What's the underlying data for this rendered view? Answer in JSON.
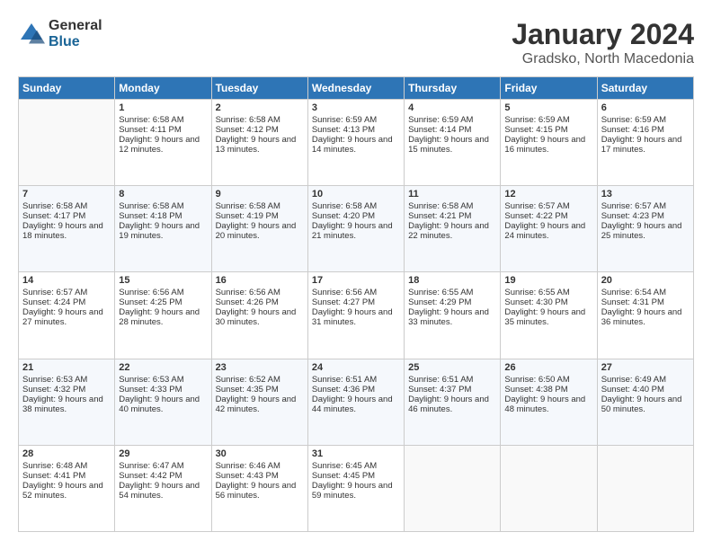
{
  "logo": {
    "general": "General",
    "blue": "Blue"
  },
  "title": "January 2024",
  "location": "Gradsko, North Macedonia",
  "days_header": [
    "Sunday",
    "Monday",
    "Tuesday",
    "Wednesday",
    "Thursday",
    "Friday",
    "Saturday"
  ],
  "weeks": [
    [
      {
        "day": "",
        "sunrise": "",
        "sunset": "",
        "daylight": ""
      },
      {
        "day": "1",
        "sunrise": "Sunrise: 6:58 AM",
        "sunset": "Sunset: 4:11 PM",
        "daylight": "Daylight: 9 hours and 12 minutes."
      },
      {
        "day": "2",
        "sunrise": "Sunrise: 6:58 AM",
        "sunset": "Sunset: 4:12 PM",
        "daylight": "Daylight: 9 hours and 13 minutes."
      },
      {
        "day": "3",
        "sunrise": "Sunrise: 6:59 AM",
        "sunset": "Sunset: 4:13 PM",
        "daylight": "Daylight: 9 hours and 14 minutes."
      },
      {
        "day": "4",
        "sunrise": "Sunrise: 6:59 AM",
        "sunset": "Sunset: 4:14 PM",
        "daylight": "Daylight: 9 hours and 15 minutes."
      },
      {
        "day": "5",
        "sunrise": "Sunrise: 6:59 AM",
        "sunset": "Sunset: 4:15 PM",
        "daylight": "Daylight: 9 hours and 16 minutes."
      },
      {
        "day": "6",
        "sunrise": "Sunrise: 6:59 AM",
        "sunset": "Sunset: 4:16 PM",
        "daylight": "Daylight: 9 hours and 17 minutes."
      }
    ],
    [
      {
        "day": "7",
        "sunrise": "Sunrise: 6:58 AM",
        "sunset": "Sunset: 4:17 PM",
        "daylight": "Daylight: 9 hours and 18 minutes."
      },
      {
        "day": "8",
        "sunrise": "Sunrise: 6:58 AM",
        "sunset": "Sunset: 4:18 PM",
        "daylight": "Daylight: 9 hours and 19 minutes."
      },
      {
        "day": "9",
        "sunrise": "Sunrise: 6:58 AM",
        "sunset": "Sunset: 4:19 PM",
        "daylight": "Daylight: 9 hours and 20 minutes."
      },
      {
        "day": "10",
        "sunrise": "Sunrise: 6:58 AM",
        "sunset": "Sunset: 4:20 PM",
        "daylight": "Daylight: 9 hours and 21 minutes."
      },
      {
        "day": "11",
        "sunrise": "Sunrise: 6:58 AM",
        "sunset": "Sunset: 4:21 PM",
        "daylight": "Daylight: 9 hours and 22 minutes."
      },
      {
        "day": "12",
        "sunrise": "Sunrise: 6:57 AM",
        "sunset": "Sunset: 4:22 PM",
        "daylight": "Daylight: 9 hours and 24 minutes."
      },
      {
        "day": "13",
        "sunrise": "Sunrise: 6:57 AM",
        "sunset": "Sunset: 4:23 PM",
        "daylight": "Daylight: 9 hours and 25 minutes."
      }
    ],
    [
      {
        "day": "14",
        "sunrise": "Sunrise: 6:57 AM",
        "sunset": "Sunset: 4:24 PM",
        "daylight": "Daylight: 9 hours and 27 minutes."
      },
      {
        "day": "15",
        "sunrise": "Sunrise: 6:56 AM",
        "sunset": "Sunset: 4:25 PM",
        "daylight": "Daylight: 9 hours and 28 minutes."
      },
      {
        "day": "16",
        "sunrise": "Sunrise: 6:56 AM",
        "sunset": "Sunset: 4:26 PM",
        "daylight": "Daylight: 9 hours and 30 minutes."
      },
      {
        "day": "17",
        "sunrise": "Sunrise: 6:56 AM",
        "sunset": "Sunset: 4:27 PM",
        "daylight": "Daylight: 9 hours and 31 minutes."
      },
      {
        "day": "18",
        "sunrise": "Sunrise: 6:55 AM",
        "sunset": "Sunset: 4:29 PM",
        "daylight": "Daylight: 9 hours and 33 minutes."
      },
      {
        "day": "19",
        "sunrise": "Sunrise: 6:55 AM",
        "sunset": "Sunset: 4:30 PM",
        "daylight": "Daylight: 9 hours and 35 minutes."
      },
      {
        "day": "20",
        "sunrise": "Sunrise: 6:54 AM",
        "sunset": "Sunset: 4:31 PM",
        "daylight": "Daylight: 9 hours and 36 minutes."
      }
    ],
    [
      {
        "day": "21",
        "sunrise": "Sunrise: 6:53 AM",
        "sunset": "Sunset: 4:32 PM",
        "daylight": "Daylight: 9 hours and 38 minutes."
      },
      {
        "day": "22",
        "sunrise": "Sunrise: 6:53 AM",
        "sunset": "Sunset: 4:33 PM",
        "daylight": "Daylight: 9 hours and 40 minutes."
      },
      {
        "day": "23",
        "sunrise": "Sunrise: 6:52 AM",
        "sunset": "Sunset: 4:35 PM",
        "daylight": "Daylight: 9 hours and 42 minutes."
      },
      {
        "day": "24",
        "sunrise": "Sunrise: 6:51 AM",
        "sunset": "Sunset: 4:36 PM",
        "daylight": "Daylight: 9 hours and 44 minutes."
      },
      {
        "day": "25",
        "sunrise": "Sunrise: 6:51 AM",
        "sunset": "Sunset: 4:37 PM",
        "daylight": "Daylight: 9 hours and 46 minutes."
      },
      {
        "day": "26",
        "sunrise": "Sunrise: 6:50 AM",
        "sunset": "Sunset: 4:38 PM",
        "daylight": "Daylight: 9 hours and 48 minutes."
      },
      {
        "day": "27",
        "sunrise": "Sunrise: 6:49 AM",
        "sunset": "Sunset: 4:40 PM",
        "daylight": "Daylight: 9 hours and 50 minutes."
      }
    ],
    [
      {
        "day": "28",
        "sunrise": "Sunrise: 6:48 AM",
        "sunset": "Sunset: 4:41 PM",
        "daylight": "Daylight: 9 hours and 52 minutes."
      },
      {
        "day": "29",
        "sunrise": "Sunrise: 6:47 AM",
        "sunset": "Sunset: 4:42 PM",
        "daylight": "Daylight: 9 hours and 54 minutes."
      },
      {
        "day": "30",
        "sunrise": "Sunrise: 6:46 AM",
        "sunset": "Sunset: 4:43 PM",
        "daylight": "Daylight: 9 hours and 56 minutes."
      },
      {
        "day": "31",
        "sunrise": "Sunrise: 6:45 AM",
        "sunset": "Sunset: 4:45 PM",
        "daylight": "Daylight: 9 hours and 59 minutes."
      },
      {
        "day": "",
        "sunrise": "",
        "sunset": "",
        "daylight": ""
      },
      {
        "day": "",
        "sunrise": "",
        "sunset": "",
        "daylight": ""
      },
      {
        "day": "",
        "sunrise": "",
        "sunset": "",
        "daylight": ""
      }
    ]
  ]
}
